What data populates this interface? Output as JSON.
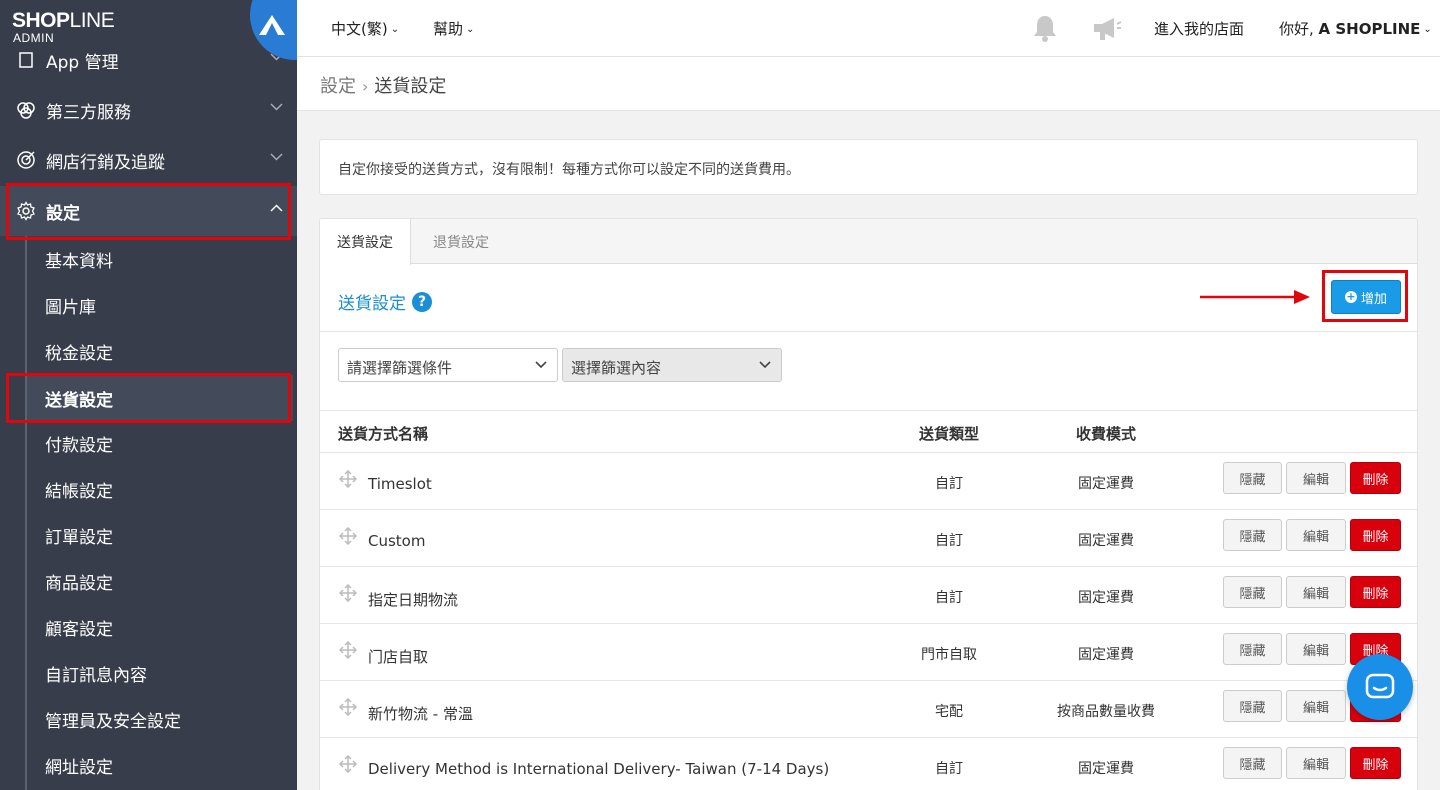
{
  "brand": {
    "name_bold": "SHOP",
    "name_light": "LINE",
    "sub": "ADMIN"
  },
  "sidebar": {
    "items": [
      {
        "label": "App 管理",
        "icon": "app-icon"
      },
      {
        "label": "第三方服務",
        "icon": "third-party-icon"
      },
      {
        "label": "網店行銷及追蹤",
        "icon": "target-icon"
      },
      {
        "label": "設定",
        "icon": "gear-icon"
      }
    ],
    "sub_items": [
      "基本資料",
      "圖片庫",
      "稅金設定",
      "送貨設定",
      "付款設定",
      "結帳設定",
      "訂單設定",
      "商品設定",
      "顧客設定",
      "自訂訊息內容",
      "管理員及安全設定",
      "網址設定"
    ]
  },
  "topbar": {
    "language": "中文(繁)",
    "help": "幫助",
    "enter_store": "進入我的店面",
    "greeting_prefix": "你好, ",
    "greeting_name": "A SHOPLINE"
  },
  "breadcrumb": {
    "parent": "設定",
    "current": "送貨設定"
  },
  "info": "自定你接受的送貨方式，沒有限制！每種方式你可以設定不同的送貨費用。",
  "tabs": [
    "送貨設定",
    "退貨設定"
  ],
  "section_title": "送貨設定",
  "add_button": "增加",
  "filters": {
    "condition": "請選擇篩選條件",
    "content": "選擇篩選內容"
  },
  "table": {
    "headers": {
      "name": "送貨方式名稱",
      "type": "送貨類型",
      "fee": "收費模式"
    },
    "rows": [
      {
        "name": "Timeslot",
        "type": "自訂",
        "fee": "固定運費"
      },
      {
        "name": "Custom",
        "type": "自訂",
        "fee": "固定運費"
      },
      {
        "name": "指定日期物流",
        "type": "自訂",
        "fee": "固定運費"
      },
      {
        "name": "门店自取",
        "type": "門市自取",
        "fee": "固定運費"
      },
      {
        "name": "新竹物流 - 常溫",
        "type": "宅配",
        "fee": "按商品數量收費"
      },
      {
        "name": "Delivery Method is International Delivery- Taiwan (7-14 Days)",
        "type": "自訂",
        "fee": "固定運費"
      }
    ],
    "actions": {
      "hide": "隱藏",
      "edit": "編輯",
      "delete": "刪除"
    }
  },
  "colors": {
    "sidebar": "#373d4b",
    "accent": "#1a8fd6",
    "danger": "#d9000d",
    "highlight": "#e0060c"
  }
}
